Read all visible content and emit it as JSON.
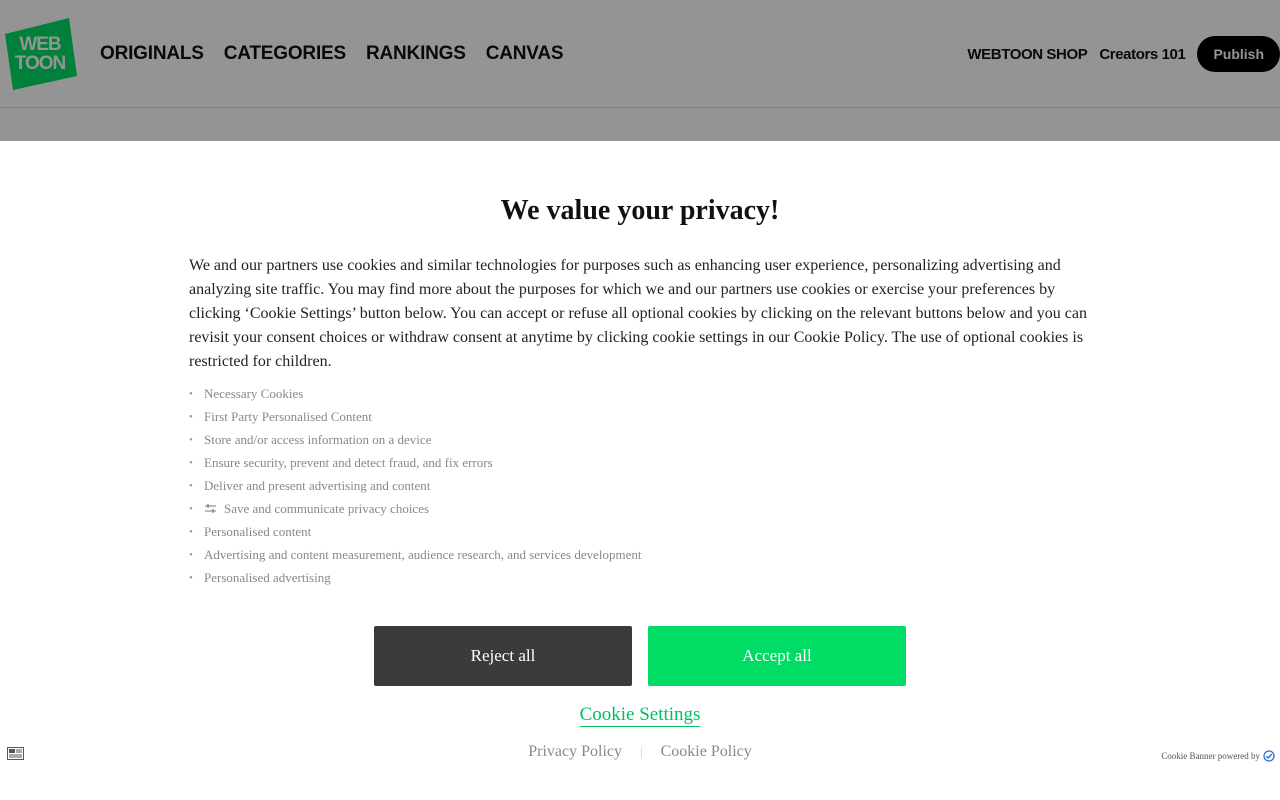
{
  "header": {
    "logo_line1": "WEB",
    "logo_line2": "TOON",
    "nav": [
      "ORIGINALS",
      "CATEGORIES",
      "RANKINGS",
      "CANVAS"
    ],
    "shop_label": "WEBTOON SHOP",
    "creators_label": "Creators 101",
    "publish_label": "Publish"
  },
  "banner": {
    "title": "We value your privacy!",
    "description": "We and our partners use cookies and similar technologies for purposes such as enhancing user experience, personalizing advertising and analyzing site traffic. You may find more about the purposes for which we and our partners use cookies or exercise your preferences by clicking ‘Cookie Settings’ button below. You can accept or refuse all optional cookies by clicking on the relevant buttons below and you can revisit your consent choices or withdraw consent at anytime by clicking cookie settings in our Cookie Policy. The use of optional cookies is restricted for children.",
    "purposes": [
      "Necessary Cookies",
      "First Party Personalised Content",
      "Store and/or access information on a device",
      "Ensure security, prevent and detect fraud, and fix errors",
      "Deliver and present advertising and content",
      "Save and communicate privacy choices",
      "Personalised content",
      "Advertising and content measurement, audience research, and services development",
      "Personalised advertising"
    ],
    "reject_label": "Reject all",
    "accept_label": "Accept all",
    "settings_label": "Cookie Settings",
    "privacy_policy_label": "Privacy Policy",
    "cookie_policy_label": "Cookie Policy",
    "powered_by_label": "Cookie Banner powered by"
  },
  "colors": {
    "brand_green": "#00dc64",
    "reject_gray": "#3b3b3b",
    "settings_link_green": "#00c060"
  },
  "icons": {
    "privacy_choice": "sliders-icon",
    "language": "language-flag-icon",
    "powered_by": "check-shield-icon"
  }
}
